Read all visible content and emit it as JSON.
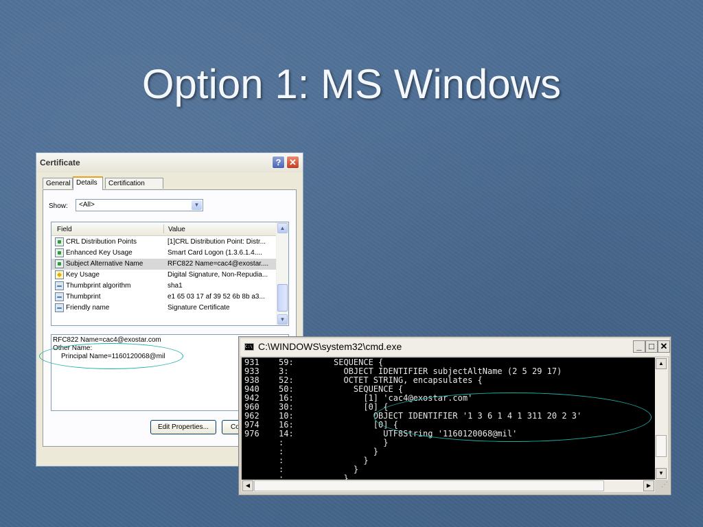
{
  "slide": {
    "title": "Option 1: MS Windows"
  },
  "certificate": {
    "window_title": "Certificate",
    "help_glyph": "?",
    "close_glyph": "✕",
    "tabs": [
      "General",
      "Details",
      "Certification Path"
    ],
    "show_label": "Show:",
    "show_value": "<All>",
    "columns": {
      "field": "Field",
      "value": "Value"
    },
    "rows": [
      {
        "field": "CRL Distribution Points",
        "value": "[1]CRL Distribution Point: Distr...",
        "icon": "certificate-extension-icon"
      },
      {
        "field": "Enhanced Key Usage",
        "value": "Smart Card Logon (1.3.6.1.4....",
        "icon": "certificate-extension-icon"
      },
      {
        "field": "Subject Alternative Name",
        "value": "RFC822 Name=cac4@exostar....",
        "icon": "certificate-extension-icon",
        "selected": true
      },
      {
        "field": "Key Usage",
        "value": "Digital Signature, Non-Repudia...",
        "icon": "critical-extension-icon"
      },
      {
        "field": "Thumbprint algorithm",
        "value": "sha1",
        "icon": "property-icon"
      },
      {
        "field": "Thumbprint",
        "value": "e1 65 03 17 af 39 52 6b 8b a3...",
        "icon": "property-icon"
      },
      {
        "field": "Friendly name",
        "value": "Signature Certificate",
        "icon": "property-icon"
      }
    ],
    "detail_lines": [
      "RFC822 Name=cac4@exostar.com",
      "Other Name:",
      "     Principal Name=1160120068@mil"
    ],
    "edit_button": "Edit Properties...",
    "copy_button": "Co"
  },
  "cmd": {
    "title": "C:\\WINDOWS\\system32\\cmd.exe",
    "icon_text": "C:\\",
    "min_glyph": "_",
    "max_glyph": "□",
    "close_glyph": "✕",
    "lines": [
      {
        "off": "931",
        "len": "59:",
        "txt": "SEQUENCE {"
      },
      {
        "off": "933",
        "len": "3:",
        "txt": "  OBJECT IDENTIFIER subjectAltName (2 5 29 17)"
      },
      {
        "off": "938",
        "len": "52:",
        "txt": "  OCTET STRING, encapsulates {"
      },
      {
        "off": "940",
        "len": "50:",
        "txt": "    SEQUENCE {"
      },
      {
        "off": "942",
        "len": "16:",
        "txt": "      [1] 'cac4@exostar.com'"
      },
      {
        "off": "960",
        "len": "30:",
        "txt": "      [0] {"
      },
      {
        "off": "962",
        "len": "10:",
        "txt": "        OBJECT IDENTIFIER '1 3 6 1 4 1 311 20 2 3'"
      },
      {
        "off": "974",
        "len": "16:",
        "txt": "        [0] {"
      },
      {
        "off": "976",
        "len": "14:",
        "txt": "          UTF8String '1160120068@mil'"
      },
      {
        "off": "",
        "len": ":",
        "txt": "          }"
      },
      {
        "off": "",
        "len": ":",
        "txt": "        }"
      },
      {
        "off": "",
        "len": ":",
        "txt": "      }"
      },
      {
        "off": "",
        "len": ":",
        "txt": "    }"
      },
      {
        "off": "",
        "len": ":",
        "txt": "  }"
      }
    ]
  },
  "colors": {
    "callout": "#1ab0a8",
    "slide_bg": "#4a6b91"
  }
}
